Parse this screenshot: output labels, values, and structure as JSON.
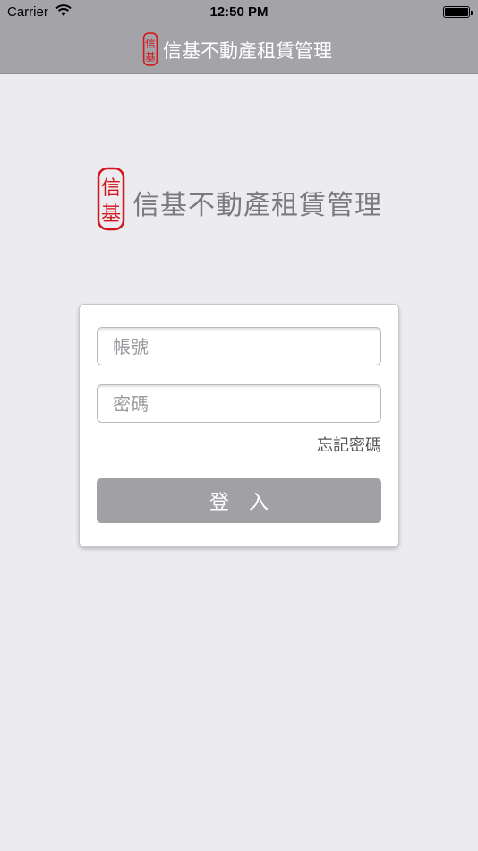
{
  "status_bar": {
    "carrier": "Carrier",
    "time": "12:50 PM",
    "wifi_icon": "wifi-icon",
    "battery_icon": "battery-icon",
    "battery_level": 1.0
  },
  "nav_bar": {
    "title": "信基不動產租賃管理",
    "logo_icon": "seal-logo-icon"
  },
  "brand": {
    "name": "信基不動產租賃管理",
    "logo_icon": "seal-logo-icon",
    "seal_chars": [
      "信",
      "基"
    ]
  },
  "login_form": {
    "account_placeholder": "帳號",
    "account_value": "",
    "password_placeholder": "密碼",
    "password_value": "",
    "forgot_password_label": "忘記密碼",
    "login_button_label": "登　入"
  },
  "colors": {
    "bar_background": "#a3a3a8",
    "page_background": "#ececf0",
    "seal_red": "#d0181e",
    "button_gray": "#a0a0a5"
  }
}
